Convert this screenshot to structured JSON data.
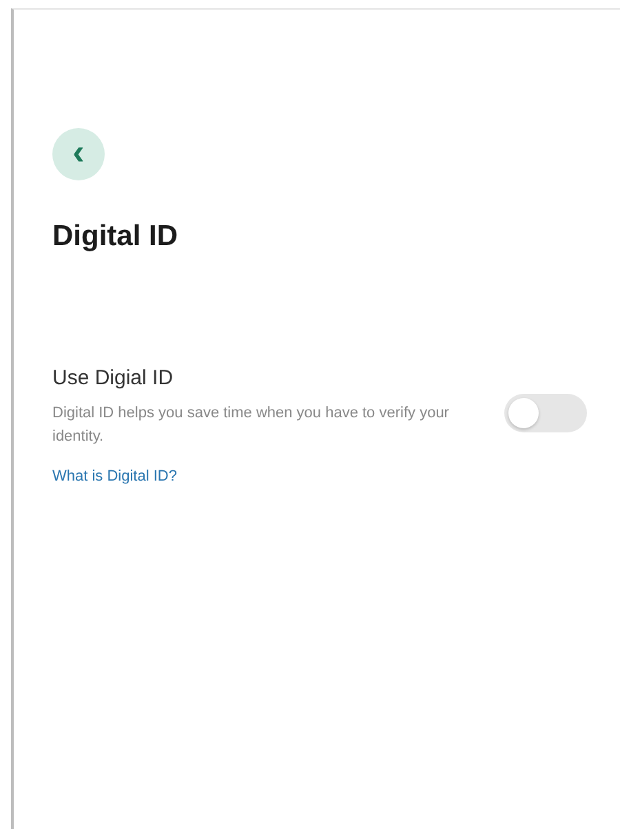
{
  "back_button": {
    "label": "‹"
  },
  "title": "Digital ID",
  "setting": {
    "label": "Use Digial ID",
    "description": "Digital ID helps you save time when you have to verify your identity.",
    "on": false,
    "link": "What is Digital ID?"
  }
}
